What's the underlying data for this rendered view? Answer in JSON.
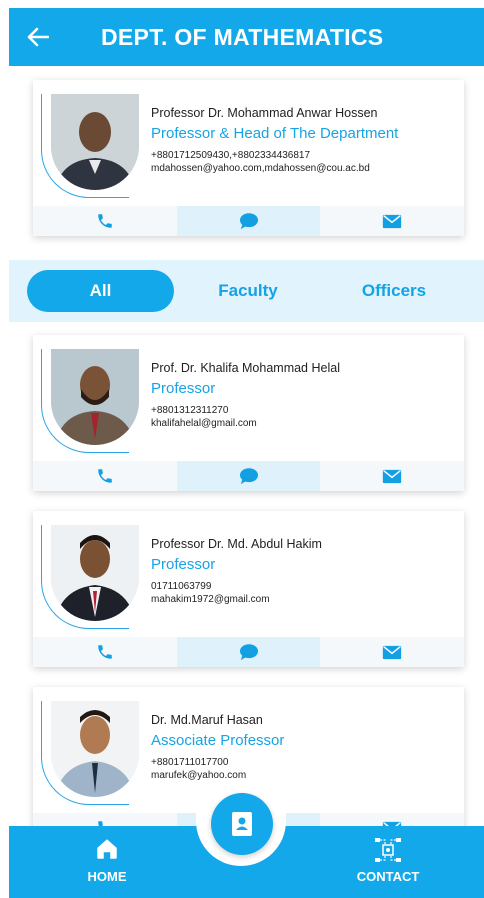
{
  "app_bar": {
    "title": "DEPT. OF MATHEMATICS"
  },
  "head": {
    "name": "Professor Dr. Mohammad Anwar Hossen",
    "designation": "Professor & Head of The Department",
    "phone": "+8801712509430,+8802334436817",
    "email": "mdahossen@yahoo.com,mdahossen@cou.ac.bd"
  },
  "tabs": [
    {
      "label": "All",
      "active": true
    },
    {
      "label": "Faculty",
      "active": false
    },
    {
      "label": "Officers",
      "active": false
    }
  ],
  "members": [
    {
      "name": "Prof. Dr. Khalifa Mohammad Helal",
      "designation": "Professor",
      "phone": "+8801312311270",
      "email": "khalifahelal@gmail.com"
    },
    {
      "name": "Professor Dr. Md. Abdul Hakim",
      "designation": "Professor",
      "phone": "01711063799",
      "email": "mahakim1972@gmail.com"
    },
    {
      "name": "Dr. Md.Maruf Hasan",
      "designation": "Associate Professor",
      "phone": "+8801711017700",
      "email": "marufek@yahoo.com"
    }
  ],
  "bottom_nav": {
    "home_label": "HOME",
    "contact_label": "CONTACT"
  },
  "icons": {
    "back": "arrow-left-icon",
    "call": "phone-icon",
    "message": "chat-bubble-icon",
    "mail": "envelope-icon",
    "home": "home-icon",
    "contact": "network-icon",
    "directory": "contact-book-icon"
  },
  "colors": {
    "primary": "#12a8ea",
    "tab_bar_bg": "#e1f3fc",
    "designation_text": "#16a4e6"
  }
}
